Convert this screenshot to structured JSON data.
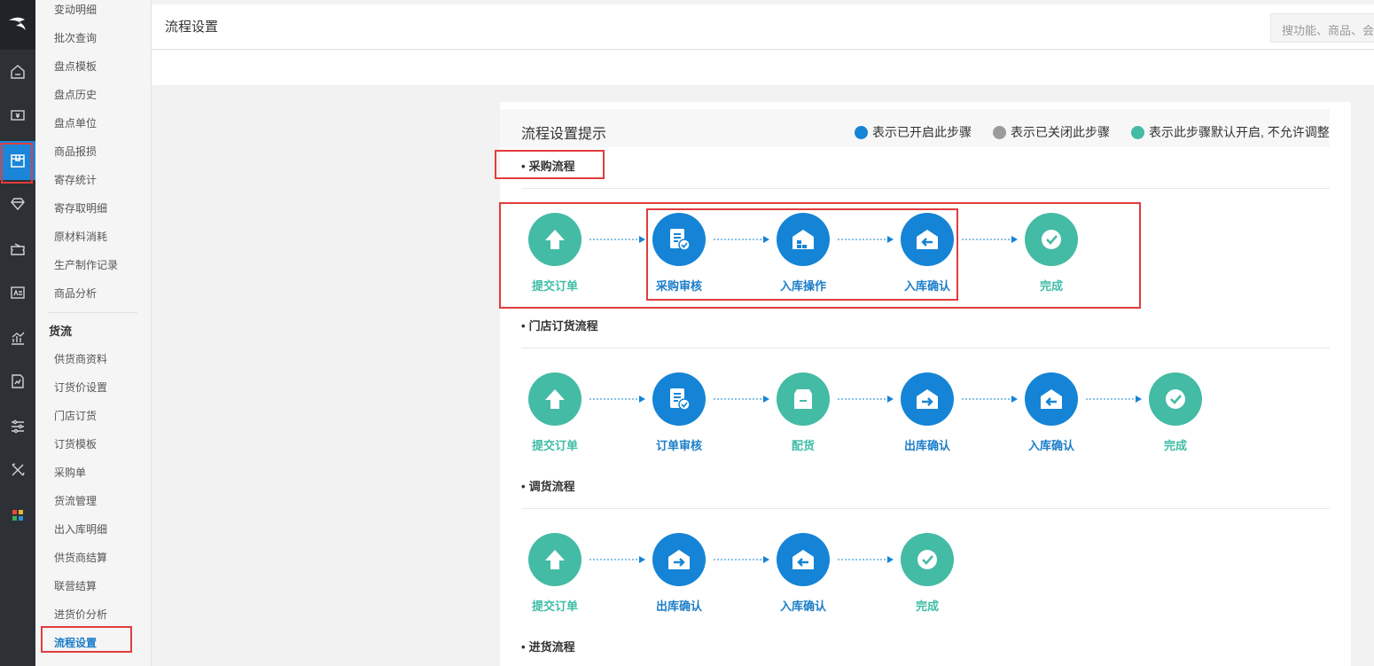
{
  "topbar": {
    "title": "流程设置",
    "search_placeholder": "搜功能、商品、会"
  },
  "rail": [
    "home-icon",
    "cash-icon",
    "goods-icon",
    "diamond-icon",
    "coupon-icon",
    "member-card-icon",
    "chart-icon",
    "report-icon",
    "settings-sliders-icon",
    "tools-icon",
    "apps-icon"
  ],
  "submenu": {
    "items_top": [
      "变动明细",
      "批次查询",
      "盘点模板",
      "盘点历史",
      "盘点单位",
      "商品报损",
      "寄存统计",
      "寄存取明细",
      "原材料消耗",
      "生产制作记录",
      "商品分析"
    ],
    "group_title": "货流",
    "items_group": [
      "供货商资料",
      "订货价设置",
      "门店订货",
      "订货模板",
      "采购单",
      "货流管理",
      "出入库明细",
      "供货商结算",
      "联营结算",
      "进货价分析",
      "流程设置"
    ]
  },
  "panel": {
    "title": "流程设置提示",
    "legend": [
      {
        "text": "表示已开启此步骤",
        "color": "#1584d6"
      },
      {
        "text": "表示已关闭此步骤",
        "color": "#9b9b9b"
      },
      {
        "text": "表示此步骤默认开启, 不允许调整",
        "color": "#44bba4"
      }
    ]
  },
  "flows": [
    {
      "title": "采购流程",
      "steps": [
        {
          "label": "提交订单",
          "state": "default",
          "icon": "upload-icon"
        },
        {
          "label": "采购审核",
          "state": "on",
          "icon": "doc-check-icon"
        },
        {
          "label": "入库操作",
          "state": "on",
          "icon": "warehouse-icon"
        },
        {
          "label": "入库确认",
          "state": "on",
          "icon": "warehouse-in-icon"
        },
        {
          "label": "完成",
          "state": "default",
          "icon": "check-icon"
        }
      ]
    },
    {
      "title": "门店订货流程",
      "steps": [
        {
          "label": "提交订单",
          "state": "default",
          "icon": "upload-icon"
        },
        {
          "label": "订单审核",
          "state": "on",
          "icon": "doc-check-icon"
        },
        {
          "label": "配货",
          "state": "default",
          "icon": "box-icon"
        },
        {
          "label": "出库确认",
          "state": "on",
          "icon": "warehouse-out-icon"
        },
        {
          "label": "入库确认",
          "state": "on",
          "icon": "warehouse-in-icon"
        },
        {
          "label": "完成",
          "state": "default",
          "icon": "check-icon"
        }
      ]
    },
    {
      "title": "调货流程",
      "steps": [
        {
          "label": "提交订单",
          "state": "default",
          "icon": "upload-icon"
        },
        {
          "label": "出库确认",
          "state": "on",
          "icon": "warehouse-out-icon"
        },
        {
          "label": "入库确认",
          "state": "on",
          "icon": "warehouse-in-icon"
        },
        {
          "label": "完成",
          "state": "default",
          "icon": "check-icon"
        }
      ]
    },
    {
      "title": "进货流程",
      "steps": []
    }
  ]
}
